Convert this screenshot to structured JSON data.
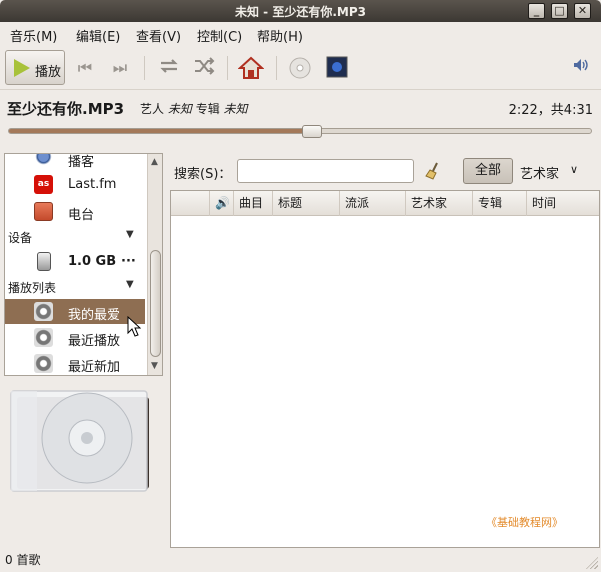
{
  "window": {
    "title": "未知 - 至少还有你.MP3",
    "buttons": {
      "minimize": "_",
      "maximize": "□",
      "close": "✕"
    }
  },
  "menubar": [
    "音乐(M)",
    "编辑(E)",
    "查看(V)",
    "控制(C)",
    "帮助(H)"
  ],
  "toolbar": {
    "play_label": "播放",
    "icons": [
      "previous-icon",
      "next-icon",
      "repeat-icon",
      "shuffle-icon",
      "home-icon",
      "cd-icon",
      "visualization-icon",
      "volume-icon"
    ]
  },
  "now_playing": {
    "title": "至少还有你.MP3",
    "artist_prefix": "艺人",
    "artist": "未知",
    "album_prefix": "专辑",
    "album": "未知",
    "time": "2:22，共4:31",
    "progress": 0.52
  },
  "sidebar": {
    "items": [
      {
        "label": "播客",
        "icon": "podcast-icon"
      },
      {
        "label": "Last.fm",
        "icon": "lastfm-icon"
      },
      {
        "label": "电台",
        "icon": "radio-icon"
      }
    ],
    "devices_header": "设备",
    "device": {
      "label": "1.0 GB",
      "more": "···",
      "icon": "portable-player-icon"
    },
    "playlists_header": "播放列表",
    "playlists": [
      {
        "label": "我的最爱",
        "selected": true,
        "icon": "smart-playlist-icon"
      },
      {
        "label": "最近播放",
        "selected": false,
        "icon": "smart-playlist-icon"
      },
      {
        "label": "最近新加",
        "selected": false,
        "icon": "smart-playlist-icon"
      }
    ]
  },
  "search": {
    "label": "搜索(S)：",
    "value": "",
    "all_button": "全部",
    "filter_label": "艺术家"
  },
  "table": {
    "columns": [
      "曲目",
      "标题",
      "流派",
      "艺术家",
      "专辑",
      "时间"
    ]
  },
  "watermark": "《基础教程网》",
  "status": "0 首歌",
  "colors": {
    "selection": "#8e6e52",
    "accent": "#a8c23a",
    "titlebar": "#3c3833"
  }
}
